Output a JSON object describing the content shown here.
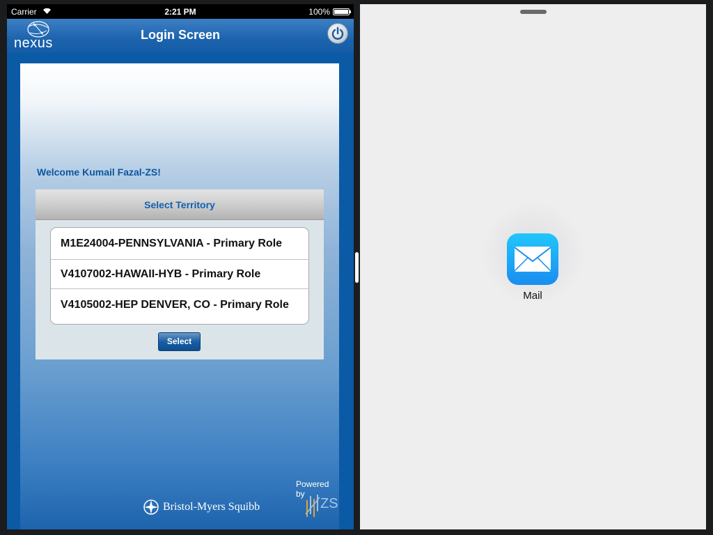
{
  "status_bar": {
    "carrier": "Carrier",
    "time": "2:21 PM",
    "battery": "100%"
  },
  "nav": {
    "title": "Login Screen",
    "logo_text": "nexus"
  },
  "welcome": "Welcome Kumail Fazal-ZS!",
  "territory": {
    "header": "Select Territory",
    "items": [
      "M1E24004-PENNSYLVANIA - Primary Role",
      "V4107002-HAWAII-HYB - Primary Role",
      "V4105002-HEP DENVER, CO - Primary Role"
    ],
    "button_label": "Select"
  },
  "footer": {
    "powered_by": "Powered by",
    "company": "Bristol-Myers Squibb",
    "partner": "ZS"
  },
  "right_pane": {
    "app_label": "Mail"
  },
  "colors": {
    "brand_blue": "#0b5aa6",
    "header_text": "#1061b0",
    "mail_blue": "#1a8df0"
  }
}
